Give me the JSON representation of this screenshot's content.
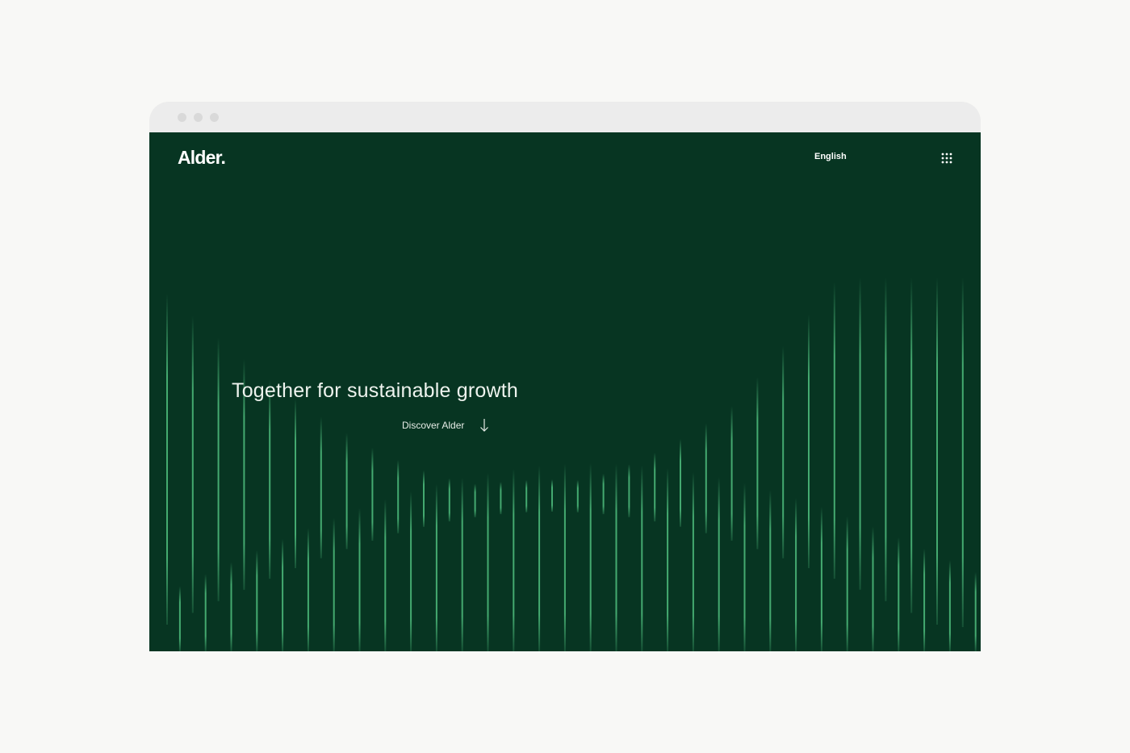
{
  "header": {
    "logo_text": "Alder.",
    "language_label": "English"
  },
  "hero": {
    "headline": "Together for sustainable growth",
    "cta_label": "Discover Alder"
  },
  "icons": {
    "menu": "grid-menu-icon",
    "cta": "arrow-down-icon"
  },
  "colors": {
    "background": "#073522",
    "line_accent": "#4fbf7e",
    "text": "#ffffff",
    "page_bg": "#f8f8f6",
    "chrome_bg": "#ececec"
  }
}
